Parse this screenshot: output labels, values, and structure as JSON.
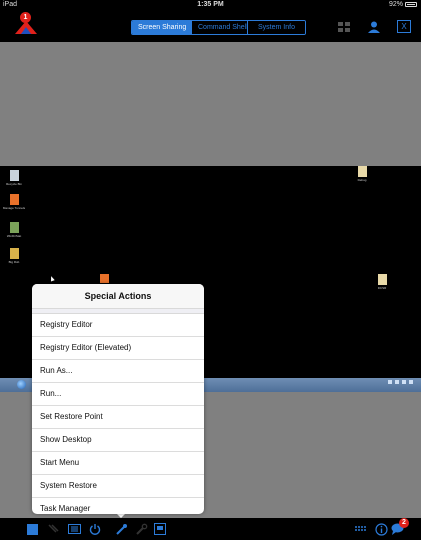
{
  "status_bar": {
    "device": "iPad",
    "time": "1:35 PM",
    "battery": "92%"
  },
  "nav": {
    "notification_count": "1",
    "tabs": [
      {
        "label": "Screen Sharing",
        "active": true
      },
      {
        "label": "Command Shell",
        "active": false
      },
      {
        "label": "System Info",
        "active": false
      }
    ],
    "close_label": "X"
  },
  "desktop_icons": [
    {
      "label": "Recycle Bin",
      "icon": "recycle-bin-icon"
    },
    {
      "label": "Manage Tunnels",
      "icon": "app-shortcut-icon"
    },
    {
      "label": "WinDirStat",
      "icon": "windirstat-icon"
    },
    {
      "label": "Big Rob",
      "icon": "folder-icon"
    },
    {
      "label": "Debug",
      "icon": "folder-icon"
    },
    {
      "label": "DCSR",
      "icon": "folder-icon"
    }
  ],
  "special_actions": {
    "title": "Special Actions",
    "items": [
      "Registry Editor",
      "Registry Editor (Elevated)",
      "Run As...",
      "Run...",
      "Set Restore Point",
      "Show Desktop",
      "Start Menu",
      "System Restore",
      "Task Manager"
    ]
  },
  "toolbar": {
    "icons": [
      "stop-icon",
      "mouse-icon",
      "keyboard-icon",
      "power-icon",
      "tools-icon",
      "wrench-icon",
      "monitor-icon",
      "keyboard-toggle-icon",
      "info-icon",
      "chat-icon"
    ],
    "chat_count": "2"
  },
  "colors": {
    "accent": "#2c7bd8",
    "badge": "#e0211b",
    "screen_gray": "#808080"
  }
}
